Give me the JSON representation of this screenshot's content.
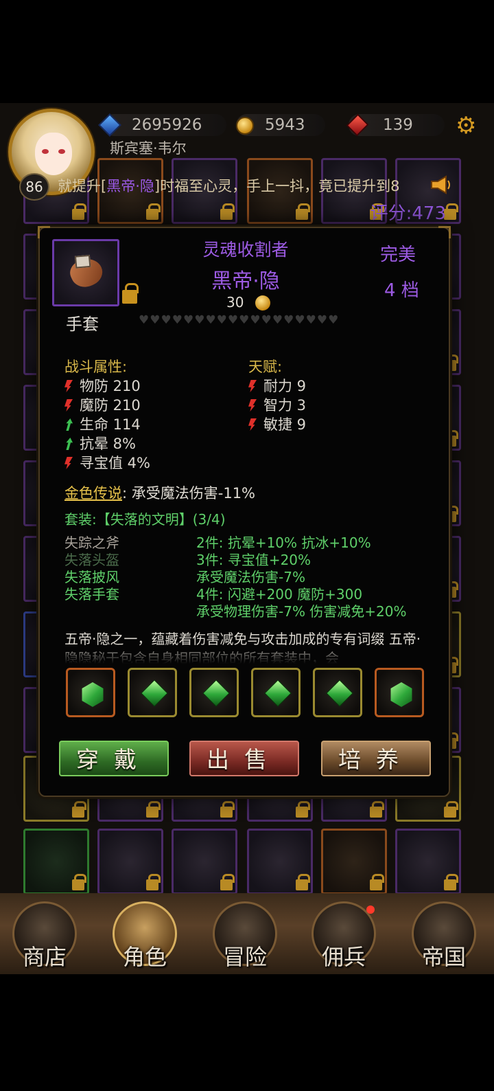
{
  "header": {
    "crystals": "2695926",
    "coins": "5943",
    "gems": "139",
    "player_name": "斯宾塞·韦尔",
    "level": "86",
    "marquee_prefix": "就提升[",
    "marquee_highlight": "黑帝·隐",
    "marquee_suffix": "]时福至心灵，手上一抖，竟已提升到8",
    "score": "评分:473"
  },
  "item": {
    "title": "灵魂收割者",
    "name": "黑帝·隐",
    "price": "30",
    "quality": "完美",
    "grade": "4 档",
    "type": "手套",
    "hearts": "♥♥♥♥♥♥♥♥♥♥♥♥♥♥♥♥♥♥"
  },
  "combat": {
    "label": "战斗属性:",
    "stats": [
      {
        "text": "物防 210",
        "dir": "down"
      },
      {
        "text": "魔防 210",
        "dir": "down"
      },
      {
        "text": "生命 114",
        "dir": "up"
      },
      {
        "text": "抗晕 8%",
        "dir": "up"
      },
      {
        "text": "寻宝值 4%",
        "dir": "down"
      }
    ]
  },
  "talent": {
    "label": "天赋:",
    "stats": [
      {
        "text": "耐力 9",
        "dir": "down"
      },
      {
        "text": "智力 3",
        "dir": "down"
      },
      {
        "text": "敏捷 9",
        "dir": "down"
      }
    ]
  },
  "legend": {
    "label": "金色传说",
    "text": ":  承受魔法伤害-11%"
  },
  "set": {
    "title": "套装:【失落的文明】(3/4)",
    "items": [
      {
        "name": "失踪之斧",
        "color": "#a8a29a"
      },
      {
        "name": "失落头盔",
        "color": "#4a6a4a"
      },
      {
        "name": "失落披风",
        "color": "#5fd06a"
      },
      {
        "name": "失落手套",
        "color": "#5fd06a"
      }
    ],
    "bonuses": [
      "2件:  抗晕+10% 抗冰+10%",
      "3件:  寻宝值+20%",
      "承受魔法伤害-7%",
      "4件:  闪避+200 魔防+300",
      "承受物理伤害-7% 伤害减免+20%"
    ]
  },
  "description": "五帝·隐之一，蕴藏着伤害减免与攻击加成的专有词缀 五帝·隐隐秘于包含自身相同部位的所有套装中，会",
  "sockets": [
    "orange-hex",
    "gold-dia",
    "gold-dia",
    "gold-dia",
    "gold-dia",
    "orange-hex"
  ],
  "buttons": {
    "wear": "穿戴",
    "sell": "出售",
    "train": "培养"
  },
  "nav": {
    "shop": "商店",
    "role": "角色",
    "adventure": "冒险",
    "mercenary": "佣兵",
    "empire": "帝国"
  }
}
